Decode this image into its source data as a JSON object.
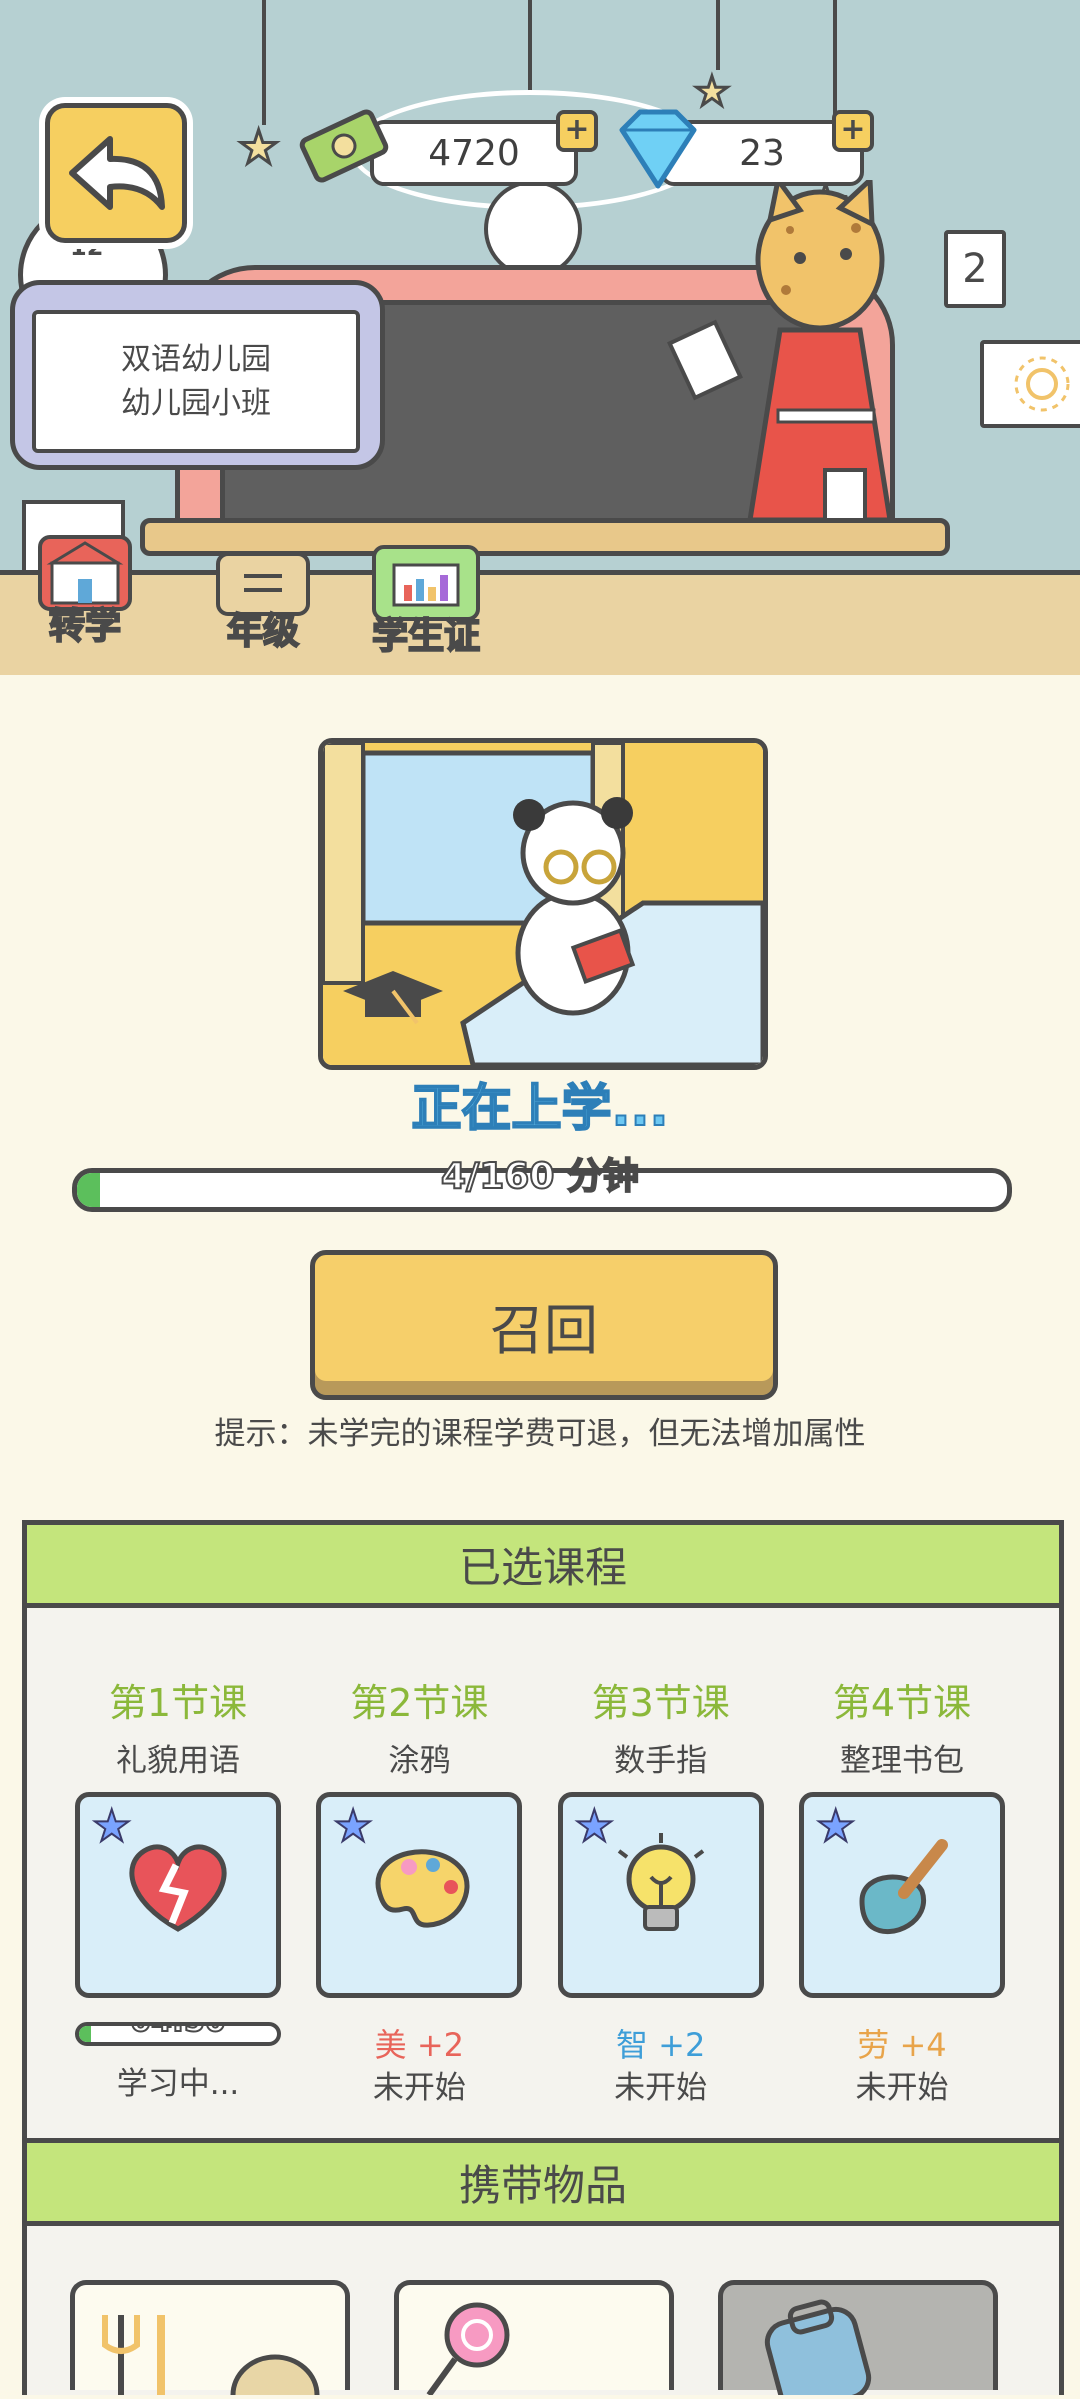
{
  "currency": {
    "cash": "4720",
    "diamonds": "23",
    "plus_label": "+"
  },
  "school": {
    "name": "双语幼儿园",
    "class": "幼儿园小班"
  },
  "scene": {
    "clock_number": "12",
    "calendar_number": "2"
  },
  "toolbar": {
    "transfer_label": "转学",
    "grade_label": "年级",
    "student_id_label": "学生证"
  },
  "status": {
    "text": "正在上学...",
    "progress_label": "4/160 分钟",
    "progress_minutes": 4,
    "progress_total": 160
  },
  "recall_button": "召回",
  "tip": "提示：未学完的课程学费可退，但无法增加属性",
  "selected_courses": {
    "title": "已选课程",
    "courses": [
      {
        "num": "第1节课",
        "name": "礼貌用语",
        "icon": "heart-icon",
        "attr": "",
        "state": "学习中...",
        "timer": "04:50",
        "timer_progress": 0.06
      },
      {
        "num": "第2节课",
        "name": "涂鸦",
        "icon": "palette-icon",
        "attr": "美 +2",
        "attr_color": "#e8645a",
        "state": "未开始"
      },
      {
        "num": "第3节课",
        "name": "数手指",
        "icon": "lightbulb-icon",
        "attr": "智 +2",
        "attr_color": "#3e9ed8",
        "state": "未开始"
      },
      {
        "num": "第4节课",
        "name": "整理书包",
        "icon": "shovel-icon",
        "attr": "劳 +4",
        "attr_color": "#e8a44a",
        "state": "未开始"
      }
    ]
  },
  "carry_items": {
    "title": "携带物品",
    "items": [
      "utensils-icon",
      "lollipop-icon",
      "backpack-icon"
    ]
  },
  "colors": {
    "accent_green": "#c4e57c",
    "button_yellow": "#f6cf6a",
    "progress_green": "#5cbf5c"
  }
}
